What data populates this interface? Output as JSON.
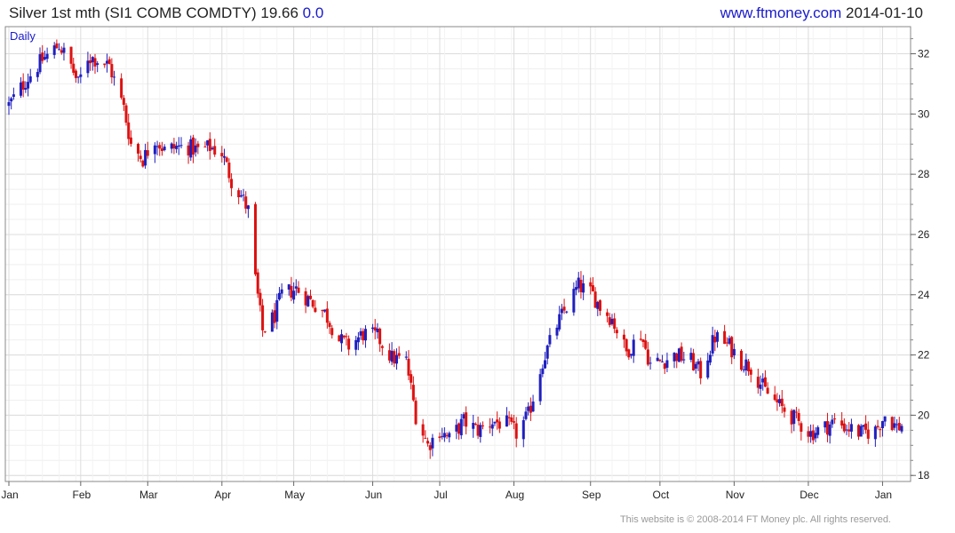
{
  "header": {
    "title": "Silver 1st mth (SI1 COMB COMDTY) 19.66",
    "change": "0.0",
    "site": "www.ftmoney.com",
    "date": "2014-01-10"
  },
  "footer": {
    "copyright": "This website is © 2008-2014 FT Money plc. All rights reserved."
  },
  "colors": {
    "up": "#1f1fbf",
    "down": "#dd1111",
    "grid": "#dcdcdc",
    "frame": "#888888",
    "text": "#222222"
  },
  "chart_data": {
    "type": "candlestick",
    "period_label": "Daily",
    "ylim": [
      17.8,
      32.9
    ],
    "y_ticks": [
      18,
      20,
      22,
      24,
      26,
      28,
      30,
      32
    ],
    "x_ticks": [
      {
        "label": "Jan",
        "date": "2013-01-02"
      },
      {
        "label": "Feb",
        "date": "2013-02-01"
      },
      {
        "label": "Mar",
        "date": "2013-03-01"
      },
      {
        "label": "Apr",
        "date": "2013-04-01"
      },
      {
        "label": "May",
        "date": "2013-05-01"
      },
      {
        "label": "Jun",
        "date": "2013-06-03"
      },
      {
        "label": "Jul",
        "date": "2013-07-01"
      },
      {
        "label": "Aug",
        "date": "2013-08-01"
      },
      {
        "label": "Sep",
        "date": "2013-09-02"
      },
      {
        "label": "Oct",
        "date": "2013-10-01"
      },
      {
        "label": "Nov",
        "date": "2013-11-01"
      },
      {
        "label": "Dec",
        "date": "2013-12-02"
      },
      {
        "label": "Jan",
        "date": "2014-01-02"
      }
    ],
    "x_range": [
      "2013-01-02",
      "2014-01-10"
    ],
    "series": [
      {
        "date": "2013-01-02",
        "close": 30.3
      },
      {
        "date": "2013-01-09",
        "close": 31.1
      },
      {
        "date": "2013-01-16",
        "close": 31.8
      },
      {
        "date": "2013-01-23",
        "close": 32.3
      },
      {
        "date": "2013-01-28",
        "close": 31.6
      },
      {
        "date": "2013-01-31",
        "close": 31.0
      },
      {
        "date": "2013-02-04",
        "close": 31.9
      },
      {
        "date": "2013-02-08",
        "close": 31.8
      },
      {
        "date": "2013-02-13",
        "close": 31.6
      },
      {
        "date": "2013-02-19",
        "close": 30.2
      },
      {
        "date": "2013-02-22",
        "close": 29.0
      },
      {
        "date": "2013-02-27",
        "close": 28.5
      },
      {
        "date": "2013-03-04",
        "close": 29.2
      },
      {
        "date": "2013-03-08",
        "close": 28.8
      },
      {
        "date": "2013-03-13",
        "close": 28.9
      },
      {
        "date": "2013-03-18",
        "close": 28.9
      },
      {
        "date": "2013-03-22",
        "close": 28.8
      },
      {
        "date": "2013-03-27",
        "close": 28.9
      },
      {
        "date": "2013-04-01",
        "close": 28.7
      },
      {
        "date": "2013-04-05",
        "close": 27.8
      },
      {
        "date": "2013-04-09",
        "close": 27.3
      },
      {
        "date": "2013-04-12",
        "close": 26.8
      },
      {
        "date": "2013-04-15",
        "close": 24.5
      },
      {
        "date": "2013-04-18",
        "close": 22.8
      },
      {
        "date": "2013-04-23",
        "close": 23.3
      },
      {
        "date": "2013-04-26",
        "close": 24.0
      },
      {
        "date": "2013-05-02",
        "close": 24.2
      },
      {
        "date": "2013-05-08",
        "close": 23.8
      },
      {
        "date": "2013-05-14",
        "close": 23.4
      },
      {
        "date": "2013-05-20",
        "close": 22.5
      },
      {
        "date": "2013-05-24",
        "close": 22.3
      },
      {
        "date": "2013-05-30",
        "close": 22.7
      },
      {
        "date": "2013-06-05",
        "close": 22.6
      },
      {
        "date": "2013-06-11",
        "close": 21.9
      },
      {
        "date": "2013-06-17",
        "close": 21.8
      },
      {
        "date": "2013-06-21",
        "close": 20.0
      },
      {
        "date": "2013-06-26",
        "close": 19.0
      },
      {
        "date": "2013-07-01",
        "close": 19.5
      },
      {
        "date": "2013-07-05",
        "close": 19.2
      },
      {
        "date": "2013-07-11",
        "close": 19.8
      },
      {
        "date": "2013-07-17",
        "close": 19.5
      },
      {
        "date": "2013-07-23",
        "close": 19.8
      },
      {
        "date": "2013-07-29",
        "close": 19.7
      },
      {
        "date": "2013-08-02",
        "close": 19.4
      },
      {
        "date": "2013-08-07",
        "close": 20.0
      },
      {
        "date": "2013-08-13",
        "close": 21.8
      },
      {
        "date": "2013-08-19",
        "close": 23.0
      },
      {
        "date": "2013-08-23",
        "close": 23.6
      },
      {
        "date": "2013-08-28",
        "close": 24.3
      },
      {
        "date": "2013-09-03",
        "close": 24.0
      },
      {
        "date": "2013-09-06",
        "close": 23.6
      },
      {
        "date": "2013-09-11",
        "close": 23.2
      },
      {
        "date": "2013-09-17",
        "close": 22.1
      },
      {
        "date": "2013-09-23",
        "close": 22.7
      },
      {
        "date": "2013-09-27",
        "close": 21.7
      },
      {
        "date": "2013-10-02",
        "close": 21.8
      },
      {
        "date": "2013-10-08",
        "close": 22.0
      },
      {
        "date": "2013-10-14",
        "close": 21.8
      },
      {
        "date": "2013-10-18",
        "close": 21.4
      },
      {
        "date": "2013-10-24",
        "close": 22.6
      },
      {
        "date": "2013-10-30",
        "close": 22.3
      },
      {
        "date": "2013-11-04",
        "close": 21.8
      },
      {
        "date": "2013-11-08",
        "close": 21.6
      },
      {
        "date": "2013-11-14",
        "close": 20.8
      },
      {
        "date": "2013-11-20",
        "close": 20.3
      },
      {
        "date": "2013-11-26",
        "close": 19.9
      },
      {
        "date": "2013-12-03",
        "close": 19.4
      },
      {
        "date": "2013-12-09",
        "close": 19.6
      },
      {
        "date": "2013-12-13",
        "close": 19.8
      },
      {
        "date": "2013-12-18",
        "close": 19.6
      },
      {
        "date": "2013-12-24",
        "close": 19.4
      },
      {
        "date": "2013-12-30",
        "close": 19.5
      },
      {
        "date": "2014-01-03",
        "close": 20.0
      },
      {
        "date": "2014-01-08",
        "close": 19.6
      },
      {
        "date": "2014-01-10",
        "close": 19.66
      }
    ]
  }
}
